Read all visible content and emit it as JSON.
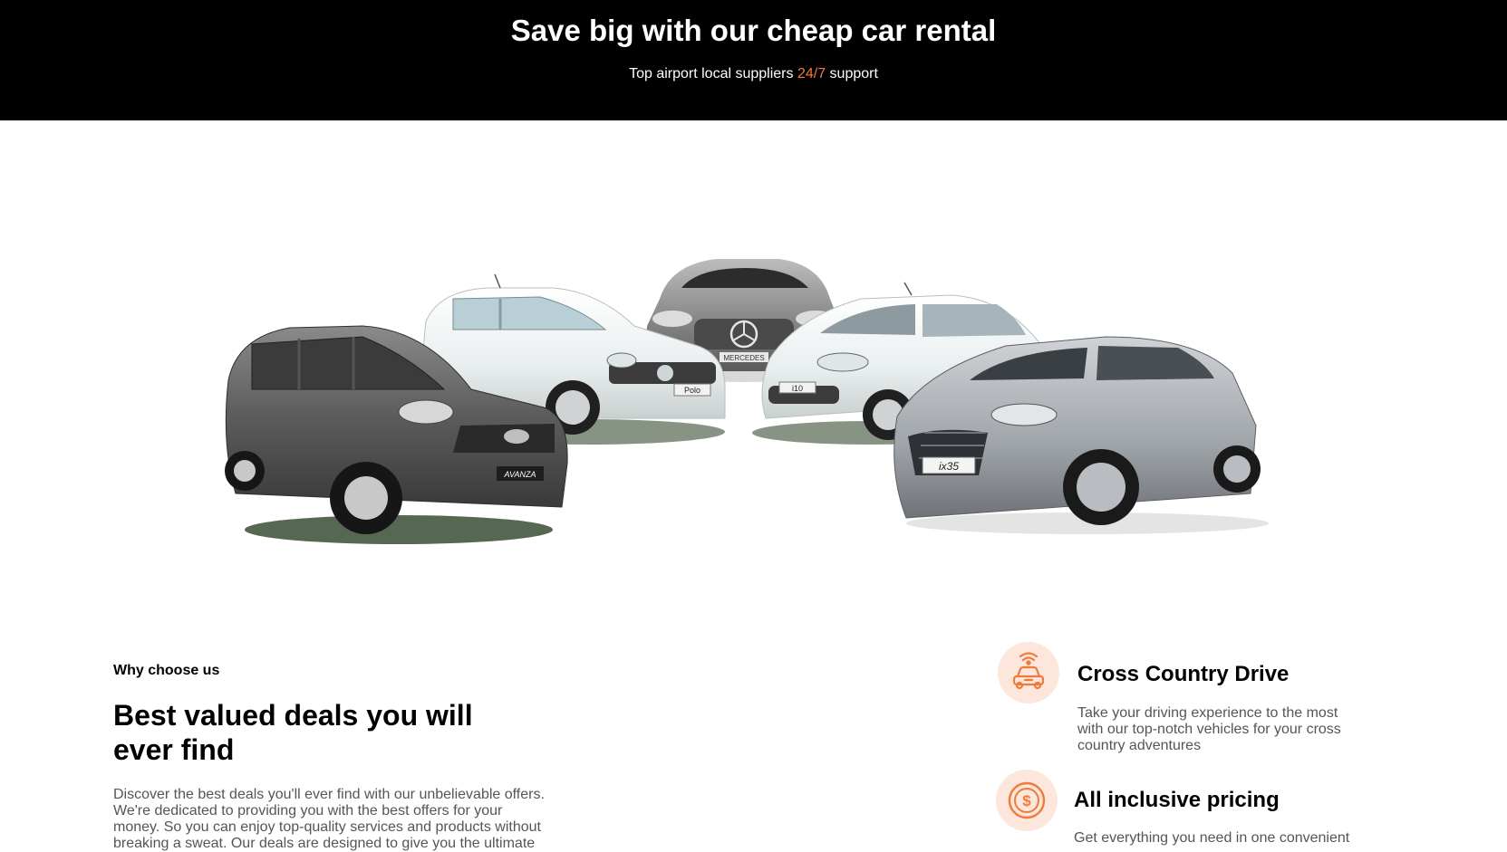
{
  "hero": {
    "title": "Save big with our cheap car rental",
    "subtitle_before": "Top airport local suppliers ",
    "subtitle_accent": "24/7",
    "subtitle_after": " support"
  },
  "cars": {
    "badges": [
      "AVANZA",
      "Polo",
      "MERCEDES",
      "i10",
      "ix35"
    ]
  },
  "why": {
    "eyebrow": "Why choose us",
    "heading": "Best valued deals you will ever find",
    "body": "Discover the best deals you'll ever find with our unbelievable offers. We're dedicated to providing you with the best offers for your money. So you can enjoy top-quality services and products without breaking a sweat. Our deals are designed to give you the ultimate"
  },
  "features": [
    {
      "icon": "car-signal-icon",
      "title": "Cross Country Drive",
      "description": "Take your driving experience to the most with our top-notch vehicles for your cross country adventures"
    },
    {
      "icon": "dollar-coin-icon",
      "title": "All inclusive pricing",
      "description": "Get everything you need in one convenient"
    }
  ],
  "colors": {
    "accent": "#f07a3c",
    "banner": "#000000",
    "icon_bg": "#fde6dc"
  }
}
